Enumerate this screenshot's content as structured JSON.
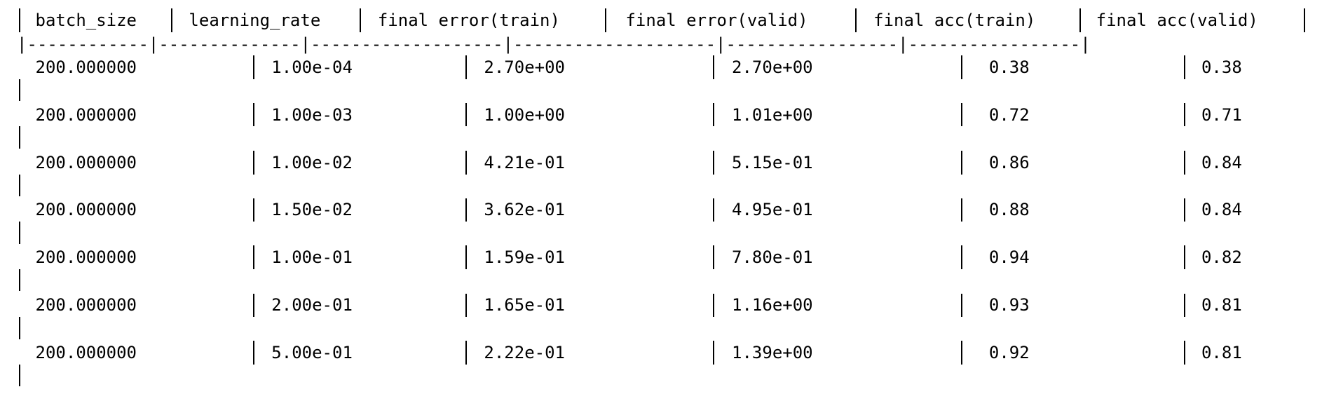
{
  "table": {
    "headers": [
      "batch_size",
      "learning_rate",
      "final error(train)",
      "final error(valid)",
      "final acc(train)",
      "final acc(valid)"
    ],
    "rows": [
      [
        "200.000000",
        "1.00e-04",
        "2.70e+00",
        "2.70e+00",
        "0.38",
        "0.38"
      ],
      [
        "200.000000",
        "1.00e-03",
        "1.00e+00",
        "1.01e+00",
        "0.72",
        "0.71"
      ],
      [
        "200.000000",
        "1.00e-02",
        "4.21e-01",
        "5.15e-01",
        "0.86",
        "0.84"
      ],
      [
        "200.000000",
        "1.50e-02",
        "3.62e-01",
        "4.95e-01",
        "0.88",
        "0.84"
      ],
      [
        "200.000000",
        "1.00e-01",
        "1.59e-01",
        "7.80e-01",
        "0.94",
        "0.82"
      ],
      [
        "200.000000",
        "2.00e-01",
        "1.65e-01",
        "1.16e+00",
        "0.93",
        "0.81"
      ],
      [
        "200.000000",
        "5.00e-01",
        "2.22e-01",
        "1.39e+00",
        "0.92",
        "0.81"
      ]
    ]
  }
}
